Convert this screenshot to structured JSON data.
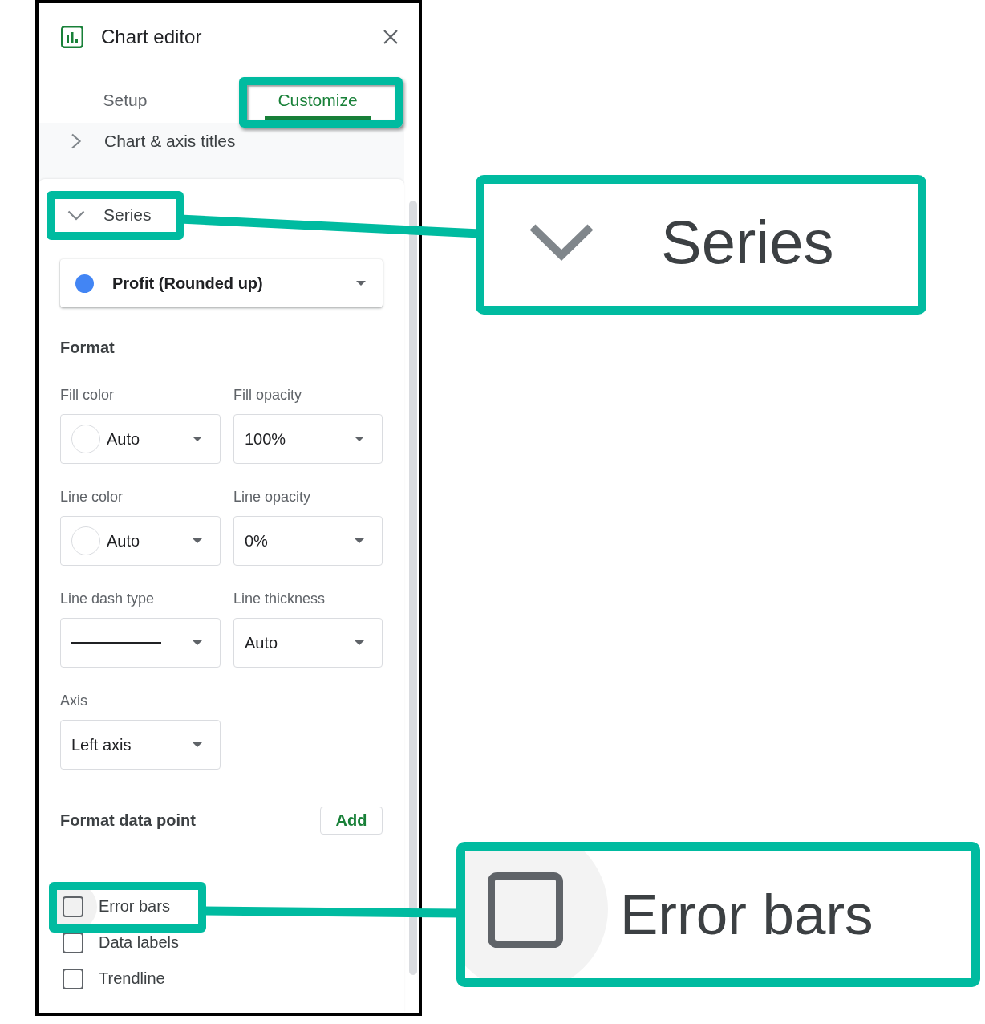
{
  "editor": {
    "title": "Chart editor",
    "tabs": [
      {
        "label": "Setup",
        "selected": false,
        "highlighted": false
      },
      {
        "label": "Customize",
        "selected": true,
        "highlighted": true
      }
    ],
    "sections": [
      {
        "title": "Chart & axis titles",
        "expanded": false,
        "highlighted": false
      },
      {
        "title": "Series",
        "expanded": true,
        "highlighted": true,
        "series_select": {
          "label": "Profit (Rounded up)",
          "color": "#4285f4"
        },
        "format_heading": "Format",
        "fields": [
          {
            "kind": "color",
            "label": "Fill color",
            "value": "Auto"
          },
          {
            "kind": "select",
            "label": "Fill opacity",
            "value": "100%"
          },
          {
            "kind": "color",
            "label": "Line color",
            "value": "Auto"
          },
          {
            "kind": "select",
            "label": "Line opacity",
            "value": "0%"
          },
          {
            "kind": "dash",
            "label": "Line dash type"
          },
          {
            "kind": "select",
            "label": "Line thickness",
            "value": "Auto"
          },
          {
            "kind": "select",
            "label": "Axis",
            "value": "Left axis"
          }
        ],
        "data_point": {
          "label": "Format data point",
          "button": "Add"
        },
        "options": [
          {
            "label": "Error bars",
            "checked": false,
            "hovered": true,
            "highlighted": true
          },
          {
            "label": "Data labels",
            "checked": false,
            "hovered": false,
            "highlighted": false
          },
          {
            "label": "Trendline",
            "checked": false,
            "hovered": false,
            "highlighted": false
          }
        ]
      }
    ]
  },
  "callouts": [
    {
      "kind": "section_header",
      "title": "Series",
      "expanded": true
    },
    {
      "kind": "checkbox",
      "label": "Error bars",
      "checked": false,
      "hovered": true
    }
  ]
}
